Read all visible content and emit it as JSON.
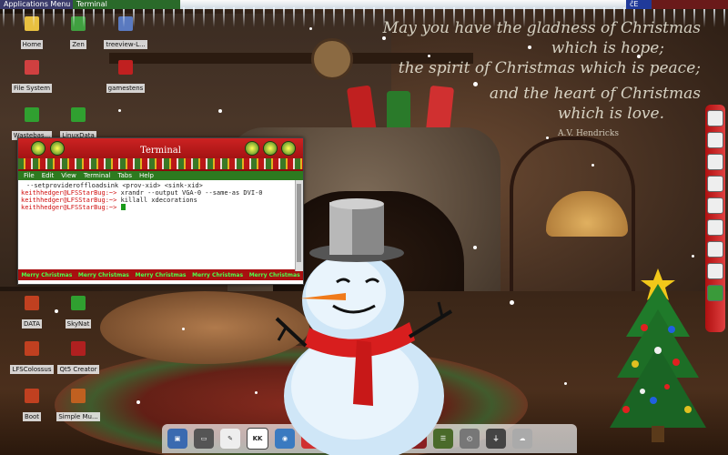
{
  "topbar": {
    "apps_menu": "Applications Menu",
    "task_terminal": "Terminal",
    "tray_text": "ĉE"
  },
  "quote": {
    "line1": "May you have the gladness of Christmas",
    "line2": "which is hope;",
    "line3": "the spirit of Christmas which is peace;",
    "line4": "and the heart of Christmas",
    "line5": "which is love.",
    "attribution": "A.V. Hendricks"
  },
  "desktop_icons": [
    {
      "label": "Home",
      "color": "#e8c040"
    },
    {
      "label": "Zen",
      "color": "#40a040"
    },
    {
      "label": "treeview-L...",
      "color": "#5a7ac0"
    },
    {
      "label": "File System",
      "color": "#d04040"
    },
    {
      "label": "gamestens",
      "color": "#c02020"
    },
    {
      "label": "Wastebas...",
      "color": "#30a030"
    },
    {
      "label": "LinuxData",
      "color": "#30a030"
    },
    {
      "label": "DATA",
      "color": "#c04020"
    },
    {
      "label": "SkyNat",
      "color": "#30a030"
    },
    {
      "label": "LFSColossus",
      "color": "#c04020"
    },
    {
      "label": "Qt5 Creator",
      "color": "#b02020"
    },
    {
      "label": "Boot",
      "color": "#c04020"
    },
    {
      "label": "Simple Mu...",
      "color": "#c06020"
    }
  ],
  "terminal": {
    "title": "Terminal",
    "menu": [
      "File",
      "Edit",
      "View",
      "Terminal",
      "Tabs",
      "Help"
    ],
    "line0": "--setprovideroffloadsink <prov-xid> <sink-xid>",
    "prompt": "keithhedger@LFSStarBug:~>",
    "cmd1": " xrandr --output VGA-0 --same-as DVI-0",
    "cmd2": " killall xdecorations",
    "cmd3": " ",
    "footer": [
      "Merry Christmas",
      "Merry Christmas",
      "Merry Christmas",
      "Merry Christmas",
      "Merry Christmas"
    ]
  },
  "bottom_dock": [
    {
      "name": "dock-finder",
      "color": "#3a6ab0",
      "glyph": "▣"
    },
    {
      "name": "dock-monitor",
      "color": "#555",
      "glyph": "▭"
    },
    {
      "name": "dock-draw",
      "color": "#eee",
      "glyph": "✎"
    },
    {
      "name": "dock-kkedit",
      "color": "#fff",
      "glyph": "KK"
    },
    {
      "name": "dock-browser",
      "color": "#3a7ac0",
      "glyph": "◉"
    },
    {
      "name": "dock-chrome",
      "color": "#d03030",
      "glyph": "◎"
    },
    {
      "name": "dock-globe",
      "color": "#3a9a3a",
      "glyph": "⊕"
    },
    {
      "name": "dock-network",
      "color": "#5a6a90",
      "glyph": "⌁"
    },
    {
      "name": "dock-mail",
      "color": "#c03030",
      "glyph": "✉"
    },
    {
      "name": "dock-calendar",
      "color": "#8a2020",
      "glyph": "11"
    },
    {
      "name": "dock-notes",
      "color": "#4a6a2a",
      "glyph": "☰"
    },
    {
      "name": "dock-clock",
      "color": "#777",
      "glyph": "◴"
    },
    {
      "name": "dock-plug",
      "color": "#444",
      "glyph": "⏚"
    },
    {
      "name": "dock-cloud",
      "color": "#aaa",
      "glyph": "☁"
    }
  ],
  "right_dock": [
    "disc",
    "speaker",
    "play",
    "eject",
    "printer",
    "calculator",
    "phone",
    "screen",
    "exit"
  ]
}
